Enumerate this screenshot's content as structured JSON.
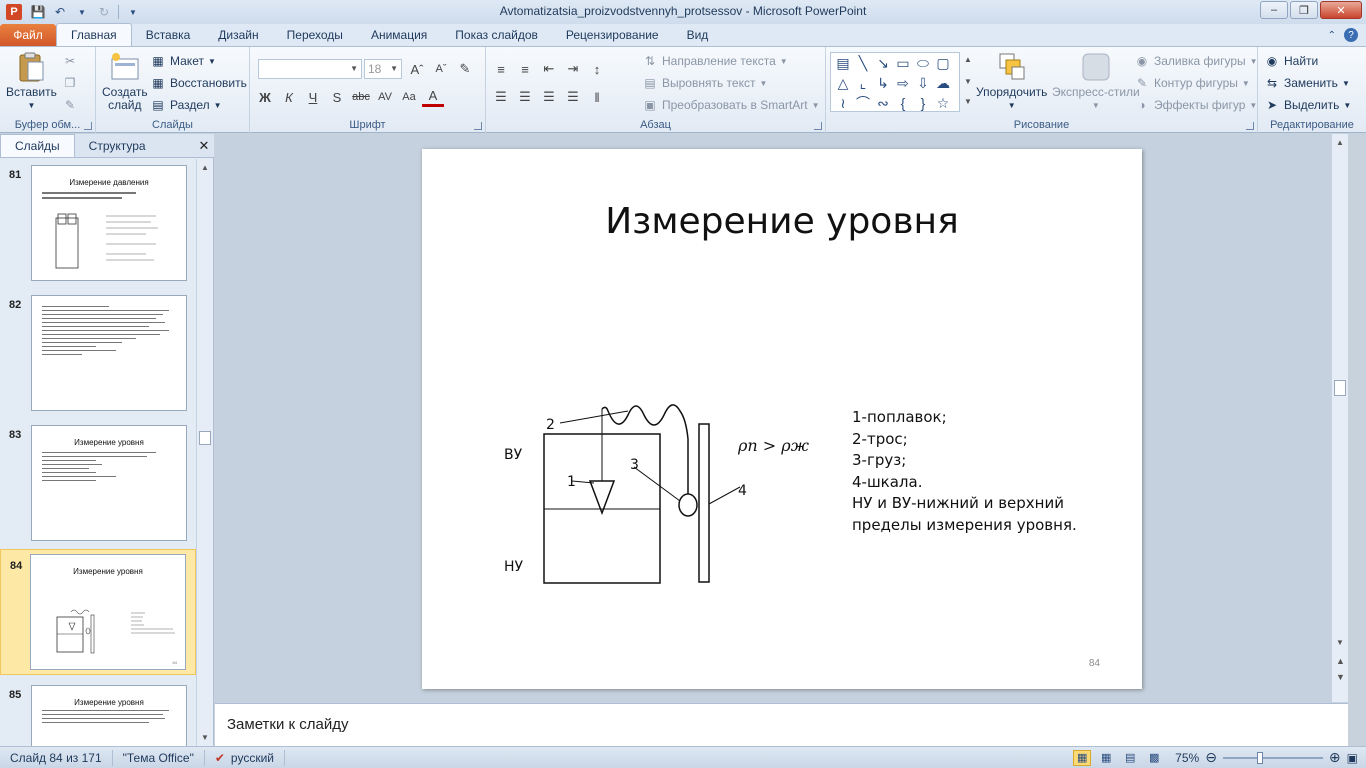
{
  "window": {
    "title": "Avtomatizatsia_proizvodstvennyh_protsessov  -  Microsoft PowerPoint",
    "logo_letter": "P"
  },
  "tabs": {
    "file": "Файл",
    "items": [
      "Главная",
      "Вставка",
      "Дизайн",
      "Переходы",
      "Анимация",
      "Показ слайдов",
      "Рецензирование",
      "Вид"
    ],
    "active": "Главная"
  },
  "ribbon": {
    "clipboard": {
      "label": "Буфер обм...",
      "paste": "Вставить"
    },
    "slides": {
      "label": "Слайды",
      "new_slide_1": "Создать",
      "new_slide_2": "слайд",
      "layout": "Макет",
      "reset": "Восстановить",
      "section": "Раздел"
    },
    "font": {
      "label": "Шрифт",
      "font_name": "",
      "font_size": "18"
    },
    "paragraph": {
      "label": "Абзац",
      "text_direction": "Направление текста",
      "align_text": "Выровнять текст",
      "smartart": "Преобразовать в SmartArt"
    },
    "drawing": {
      "label": "Рисование",
      "arrange": "Упорядочить",
      "quick_styles": "Экспресс-стили",
      "shape_fill": "Заливка фигуры",
      "shape_outline": "Контур фигуры",
      "shape_effects": "Эффекты фигур"
    },
    "editing": {
      "label": "Редактирование",
      "find": "Найти",
      "replace": "Заменить",
      "select": "Выделить"
    }
  },
  "left_panel": {
    "tab_slides": "Слайды",
    "tab_outline": "Структура",
    "thumbnails": [
      {
        "num": "81",
        "title": "Измерение давления"
      },
      {
        "num": "82",
        "title": ""
      },
      {
        "num": "83",
        "title": "Измерение уровня"
      },
      {
        "num": "84",
        "title": "Измерение уровня"
      },
      {
        "num": "85",
        "title": "Измерение уровня"
      }
    ],
    "selected": "84"
  },
  "slide": {
    "title": "Измерение уровня",
    "legend": [
      "1-поплавок;",
      "2-трос;",
      "3-груз;",
      "4-шкала.",
      "НУ и ВУ-нижний и верхний",
      "пределы измерения уровня."
    ],
    "page_number": "84",
    "diagram": {
      "label_vu": "ВУ",
      "label_nu": "НУ",
      "label_1": "1",
      "label_2": "2",
      "label_3": "3",
      "label_4": "4",
      "formula": "ρп > ρж"
    }
  },
  "notes": {
    "placeholder": "Заметки к слайду"
  },
  "status": {
    "slide_info": "Слайд 84 из 171",
    "theme": "\"Тема Office\"",
    "language": "русский",
    "zoom": "75%",
    "zoom_fraction": 0.75
  }
}
